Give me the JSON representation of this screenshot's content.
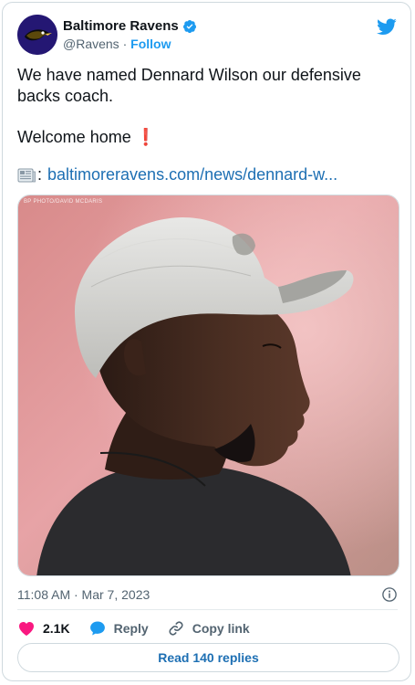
{
  "author": {
    "display_name": "Baltimore Ravens",
    "handle": "@Ravens",
    "separator": "·",
    "follow_label": "Follow"
  },
  "tweet": {
    "line1": "We have named Dennard Wilson our defensive backs coach.",
    "line2": "Welcome home",
    "line2_emoji": "❗",
    "link_emoji": "📰",
    "link_prefix": ":",
    "link_text": "baltimoreravens.com/news/dennard-w..."
  },
  "media": {
    "credit": "BP PHOTO/DAVID MCDARIS"
  },
  "meta": {
    "timestamp": "11:08 AM · Mar 7, 2023"
  },
  "actions": {
    "likes": "2.1K",
    "reply_label": "Reply",
    "copy_link_label": "Copy link"
  },
  "read_replies_label": "Read 140 replies",
  "colors": {
    "brand_purple": "#241773",
    "twitter_blue": "#1d9bf0",
    "link_blue": "#1d6fb3",
    "like_pink": "#f91880"
  }
}
